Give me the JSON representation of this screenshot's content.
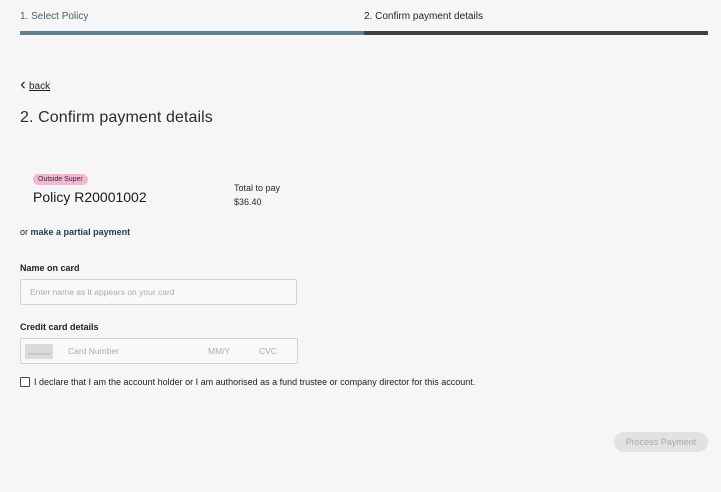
{
  "stepper": {
    "steps": [
      {
        "label": "1. Select Policy",
        "state": "completed"
      },
      {
        "label": "2. Confirm payment details",
        "state": "current"
      }
    ],
    "colors": {
      "completed": "#5f7f97",
      "current": "#3f4144"
    }
  },
  "back": {
    "label": "back",
    "icon": "chevron-left-icon"
  },
  "page_title": "2. Confirm payment details",
  "policy": {
    "badge": "Outside Super",
    "name": "Policy R20001002",
    "total_label": "Total to pay",
    "total_amount": "$36.40"
  },
  "partial": {
    "prefix": "or",
    "link": "make a partial payment"
  },
  "name_on_card": {
    "label": "Name on card",
    "value": "",
    "placeholder": "Enter name as it appears on your card"
  },
  "credit_card": {
    "label": "Credit card details",
    "icon": "credit-card-icon",
    "number_placeholder": "Card Number",
    "expiry_placeholder": "MM/Y",
    "cvc_placeholder": "CVC"
  },
  "declaration": {
    "checked": false,
    "text": "I declare that I am the account holder or I am authorised as a fund trustee or company director for this account."
  },
  "process_button": {
    "label": "Process Payment",
    "enabled": false
  }
}
